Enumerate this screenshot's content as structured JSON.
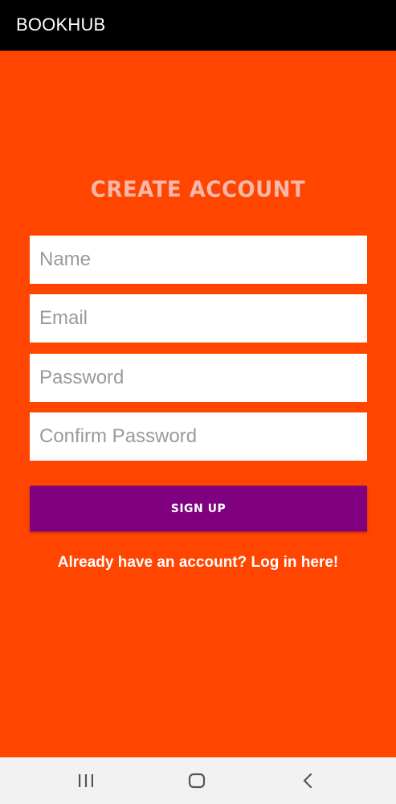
{
  "app_bar": {
    "title": "BOOKHUB"
  },
  "form": {
    "heading": "CREATE ACCOUNT",
    "fields": {
      "name_placeholder": "Name",
      "email_placeholder": "Email",
      "password_placeholder": "Password",
      "confirm_password_placeholder": "Confirm Password"
    },
    "signup_label": "SIGN UP",
    "login_link": "Already have an account? Log in here!"
  },
  "system_nav": {
    "buttons": [
      "recents-icon",
      "home-icon",
      "back-icon"
    ]
  },
  "colors": {
    "background": "#ff4500",
    "app_bar": "#000000",
    "heading": "#f6b8a8",
    "signup_button": "#800080",
    "nav_bar": "#f2f2f2"
  }
}
